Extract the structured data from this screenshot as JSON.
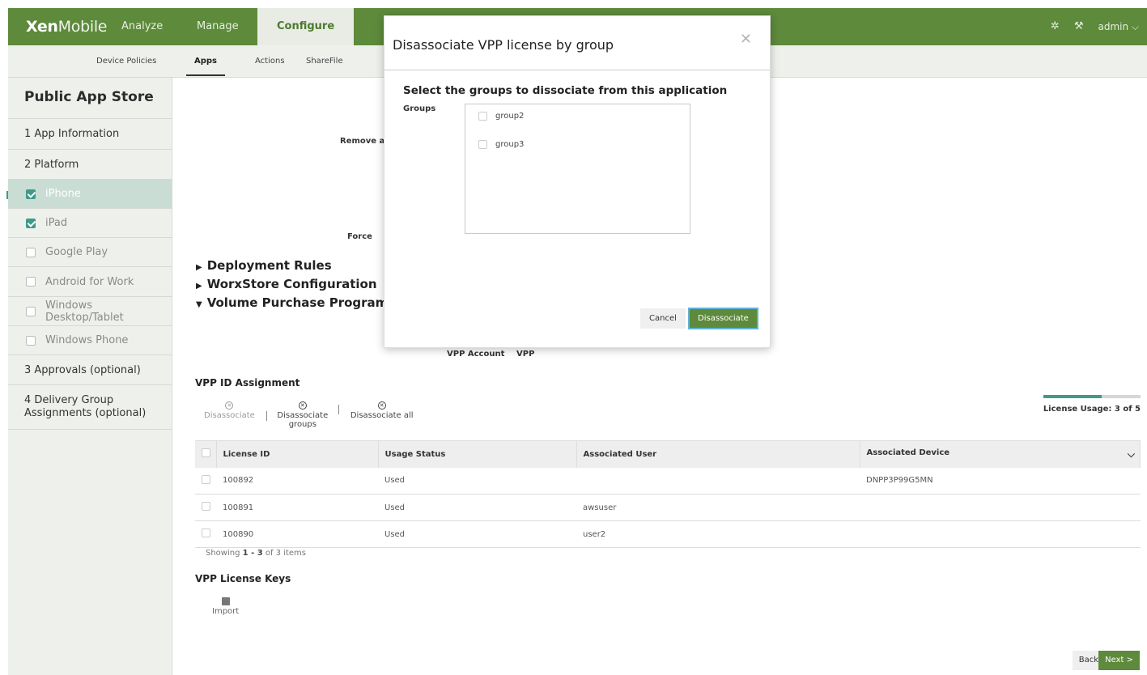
{
  "brand": {
    "bold": "Xen",
    "light": "Mobile"
  },
  "topnav": {
    "analyze": "Analyze",
    "manage": "Manage",
    "configure": "Configure",
    "user": "admin ⌵"
  },
  "subnav": {
    "device_policies": "Device Policies",
    "apps": "Apps",
    "actions": "Actions",
    "sharefile": "ShareFile"
  },
  "left_panel": {
    "title": "Public App Store",
    "items": [
      {
        "label": "1 App Information"
      },
      {
        "label": "2 Platform"
      },
      {
        "label": "iPhone",
        "checked": true
      },
      {
        "label": "iPad",
        "checked": true
      },
      {
        "label": "Google Play",
        "checked": false
      },
      {
        "label": "Android for Work",
        "checked": false
      },
      {
        "label": "Windows Desktop/Tablet",
        "checked": false
      },
      {
        "label": "Windows Phone",
        "checked": false
      },
      {
        "label": "3 Approvals (optional)"
      },
      {
        "label": "4 Delivery Group Assignments (optional)"
      }
    ]
  },
  "main": {
    "partial_label_1": "Remove ap",
    "partial_label_2": "Force",
    "sections": [
      "Deployment Rules",
      "WorxStore Configuration",
      "Volume Purchase Program"
    ],
    "vpp_account_label": "VPP Account",
    "vpp_account_value": "VPP",
    "vpp_id_title": "VPP ID Assignment",
    "toolbar": {
      "disassociate": "Disassociate",
      "disassociate_groups": "Disassociate groups",
      "disassociate_all": "Disassociate all"
    },
    "license_usage": "License Usage: 3 of 5",
    "license_usage_fraction": 0.6,
    "table": {
      "headers": [
        "License ID",
        "Usage Status",
        "Associated User",
        "Associated Device"
      ],
      "rows": [
        [
          "100892",
          "Used",
          "",
          "DNPP3P99G5MN"
        ],
        [
          "100891",
          "Used",
          "awsuser",
          ""
        ],
        [
          "100890",
          "Used",
          "user2",
          ""
        ]
      ]
    },
    "showing_prefix": "Showing ",
    "showing_range": "1 - 3",
    "showing_suffix": " of 3 items",
    "keys_title": "VPP License Keys",
    "import": "Import",
    "back": "Back",
    "next": "Next >"
  },
  "modal": {
    "title": "Disassociate VPP license by group",
    "subtitle": "Select the groups to dissociate from this application",
    "groups_label": "Groups",
    "groups": [
      "group2",
      "group3"
    ],
    "cancel": "Cancel",
    "confirm": "Disassociate"
  }
}
